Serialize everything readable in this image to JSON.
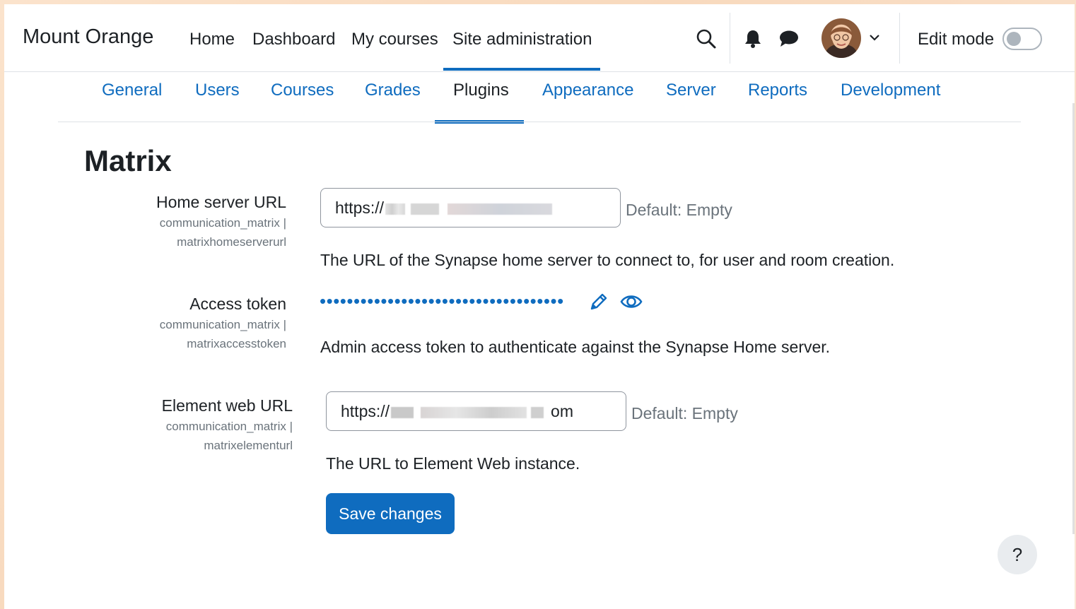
{
  "brand": "Mount Orange",
  "primary_nav": [
    "Home",
    "Dashboard",
    "My courses",
    "Site administration"
  ],
  "edit_mode_label": "Edit mode",
  "edit_mode_on": false,
  "secondary_nav": [
    "General",
    "Users",
    "Courses",
    "Grades",
    "Plugins",
    "Appearance",
    "Server",
    "Reports",
    "Development"
  ],
  "secondary_active": "Plugins",
  "page_title": "Matrix",
  "settings": {
    "home_server": {
      "label": "Home server URL",
      "key_line1": "communication_matrix |",
      "key_line2": "matrixhomeserverurl",
      "value_prefix": "https://",
      "default": "Default: Empty",
      "description": "The URL of the Synapse home server to connect to, for user and room creation."
    },
    "access_token": {
      "label": "Access token",
      "key_line1": "communication_matrix |",
      "key_line2": "matrixaccesstoken",
      "masked_value": "••••••••••••••••••••••••••••••••••••",
      "description": "Admin access token to authenticate against the Synapse Home server."
    },
    "element_web": {
      "label": "Element web URL",
      "key_line1": "communication_matrix |",
      "key_line2": "matrixelementurl",
      "value_prefix": "https://",
      "value_suffix": "om",
      "default": "Default: Empty",
      "description": "The URL to Element Web instance."
    }
  },
  "save_button": "Save changes",
  "help_button": "?",
  "colors": {
    "accent": "#0f6cbf",
    "text": "#1d2125",
    "muted": "#6a737b"
  },
  "icons": [
    "search-icon",
    "bell-icon",
    "chat-icon",
    "chevron-down-icon",
    "pencil-icon",
    "eye-icon"
  ]
}
